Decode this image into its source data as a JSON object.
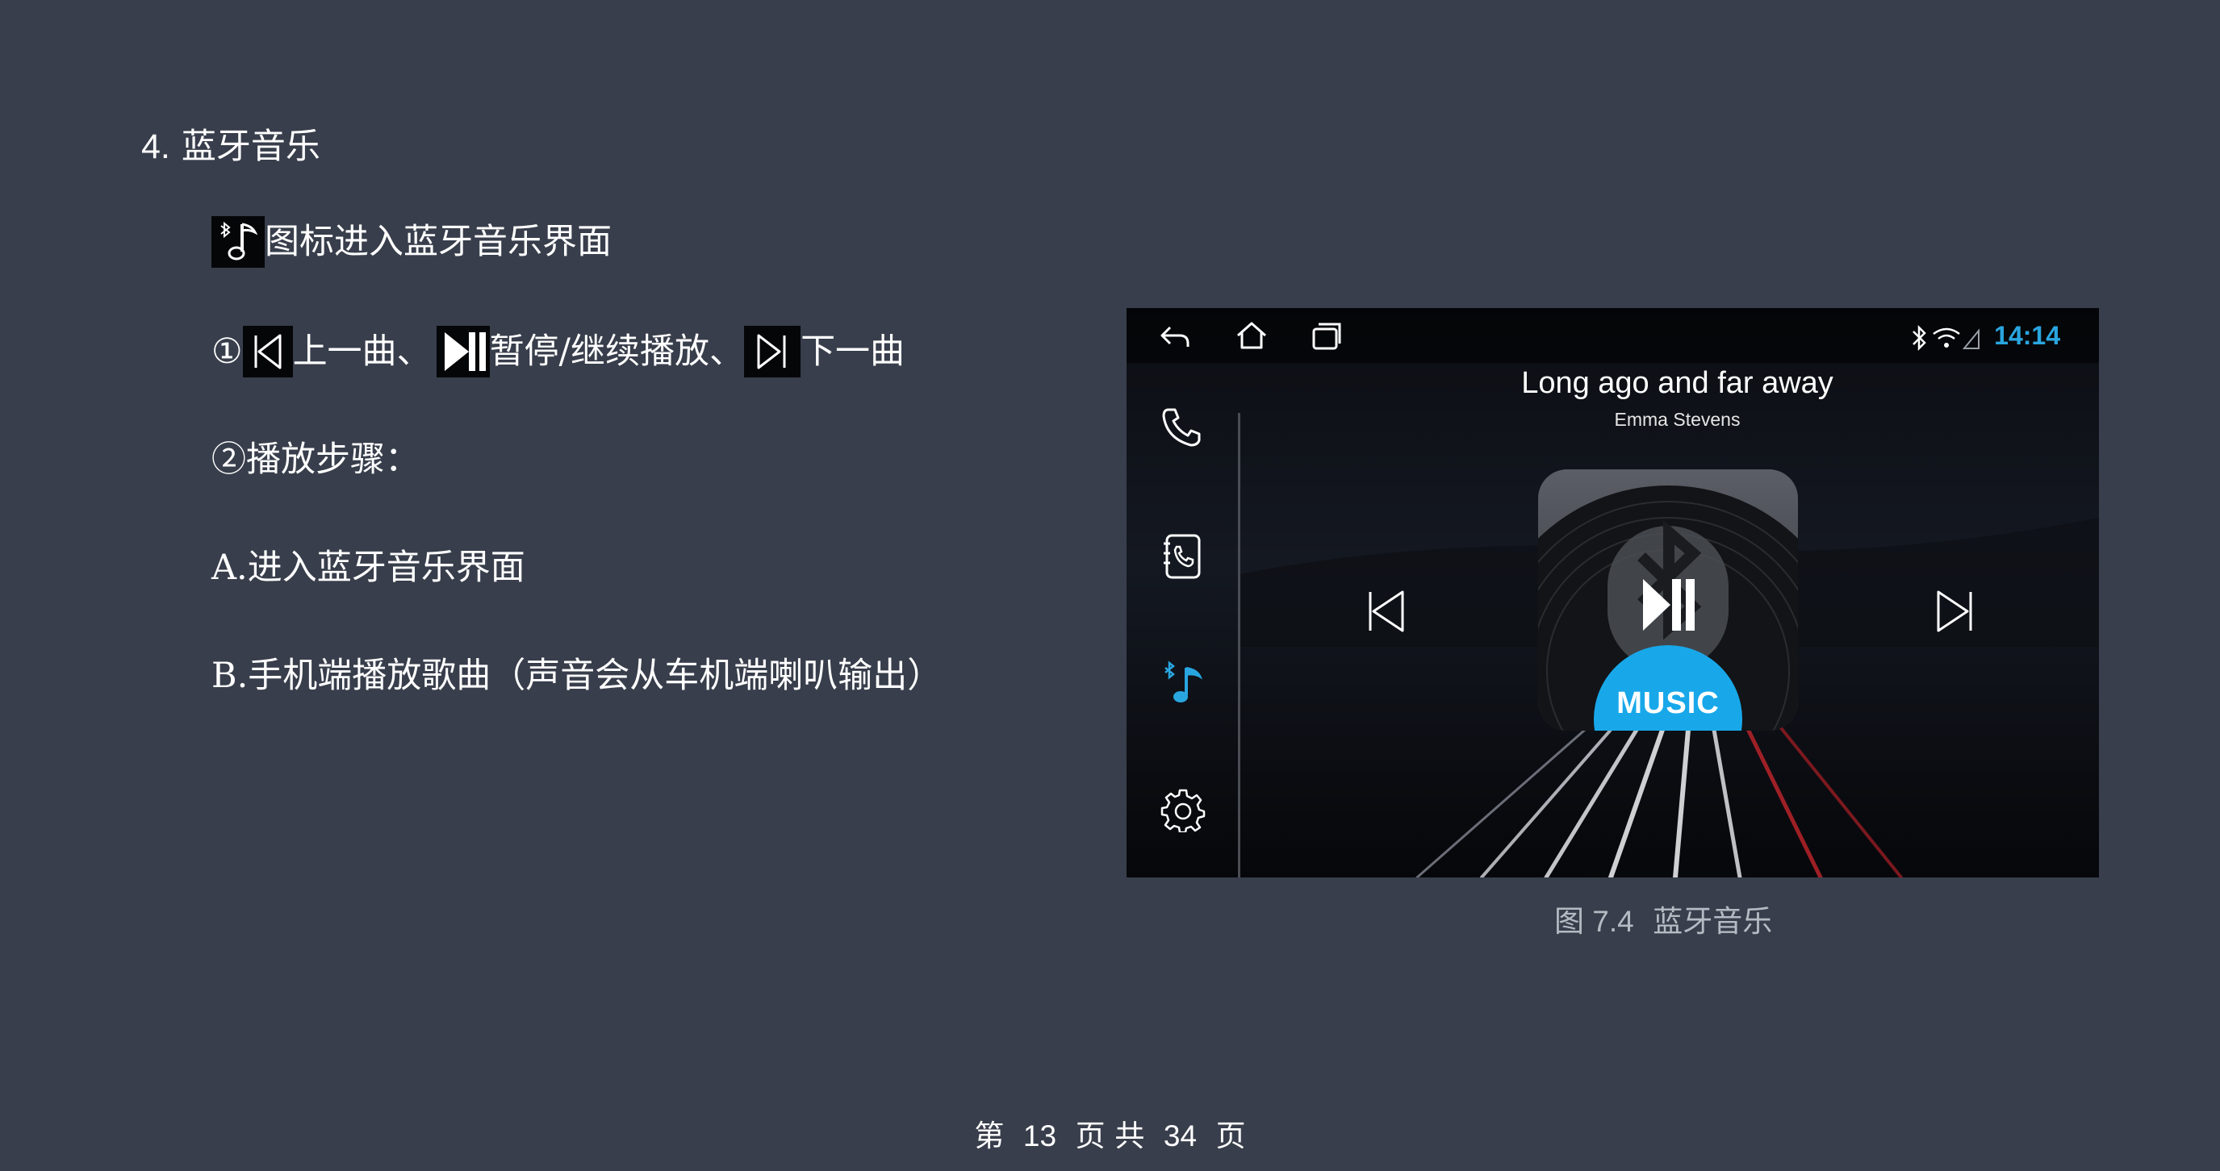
{
  "heading": {
    "number": "4.",
    "title": "蓝牙音乐"
  },
  "intro": {
    "text": "图标进入蓝牙音乐界面",
    "icon": "bluetooth-music-icon"
  },
  "controls_line": {
    "marker": "①",
    "prev_label": "上一曲、",
    "play_pause_label": "暂停/继续播放、",
    "next_label": "下一曲",
    "icons": [
      "previous-track-icon",
      "play-pause-icon",
      "next-track-icon"
    ]
  },
  "steps_heading": "②播放步骤：",
  "step_a": "A.进入蓝牙音乐界面",
  "step_b": "B.手机端播放歌曲（声音会从车机端喇叭输出）",
  "screenshot": {
    "clock": "14:14",
    "song_title": "Long ago and far away",
    "artist": "Emma Stevens",
    "cover_label": "MUSIC",
    "accent_color": "#29a6e0",
    "sidebar_items": [
      "phone-icon",
      "contacts-icon",
      "bluetooth-music-icon",
      "settings-icon"
    ],
    "nav_items": [
      "back-icon",
      "home-icon",
      "recent-apps-icon"
    ],
    "status_icons": [
      "bluetooth-icon",
      "wifi-icon",
      "signal-icon"
    ]
  },
  "caption": {
    "figure": "图 7.4",
    "text": "蓝牙音乐"
  },
  "footer": {
    "prefix": "第",
    "page": "13",
    "middle": "页 共",
    "total": "34",
    "suffix": "页"
  }
}
